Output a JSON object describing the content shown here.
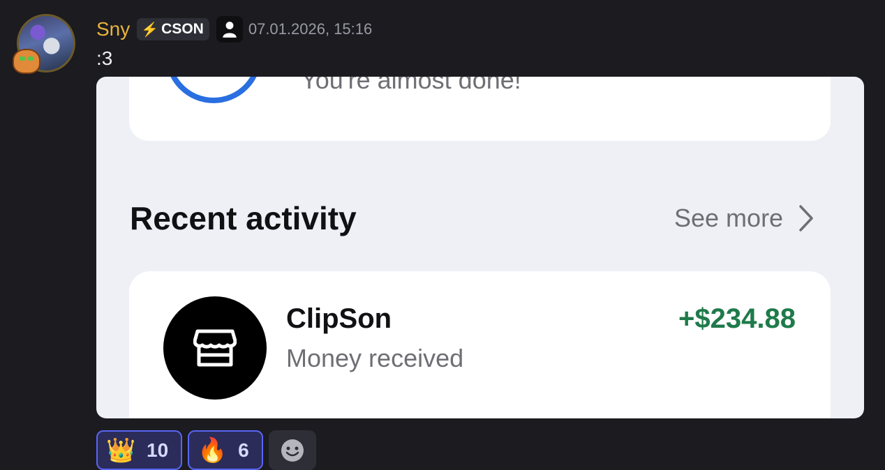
{
  "message": {
    "author": "Sny",
    "tag": {
      "icon": "bolt-icon",
      "label": "CSON"
    },
    "role_icon": "person-icon",
    "timestamp": "07.01.2026, 15:16",
    "text": ":3"
  },
  "attachment": {
    "top_card_text": "You're almost done!",
    "section_title": "Recent activity",
    "see_more": "See more",
    "activity": {
      "merchant": "ClipSon",
      "type": "Money received",
      "amount": "+$234.88",
      "icon": "storefront-icon"
    }
  },
  "reactions": [
    {
      "emoji": "👑",
      "icon": "crown-icon",
      "count": "10"
    },
    {
      "emoji": "🔥",
      "icon": "fire-icon",
      "count": "6"
    }
  ],
  "colors": {
    "background": "#1b1b20",
    "username": "#e8b33c",
    "amount_green": "#1f7a4a",
    "reaction_border": "#5865f2",
    "progress_blue": "#2a6fe0"
  }
}
